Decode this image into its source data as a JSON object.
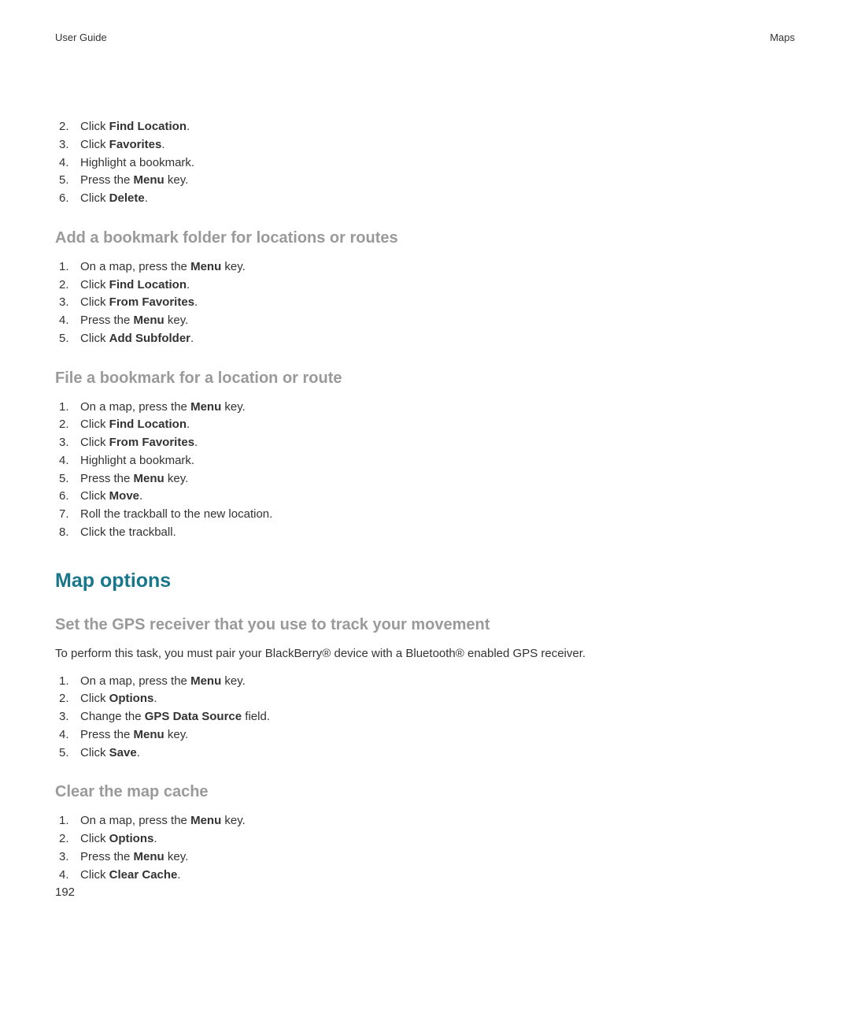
{
  "header": {
    "left": "User Guide",
    "right": "Maps"
  },
  "list1": {
    "start": 2,
    "items": [
      {
        "prefix": "Click ",
        "bold": "Find Location",
        "suffix": "."
      },
      {
        "prefix": "Click ",
        "bold": "Favorites",
        "suffix": "."
      },
      {
        "prefix": "Highlight a bookmark.",
        "bold": "",
        "suffix": ""
      },
      {
        "prefix": "Press the ",
        "bold": "Menu",
        "suffix": " key."
      },
      {
        "prefix": "Click ",
        "bold": "Delete",
        "suffix": "."
      }
    ]
  },
  "section2": {
    "heading": "Add a bookmark folder for locations or routes",
    "items": [
      {
        "prefix": "On a map, press the ",
        "bold": "Menu",
        "suffix": " key."
      },
      {
        "prefix": "Click ",
        "bold": "Find Location",
        "suffix": "."
      },
      {
        "prefix": "Click ",
        "bold": "From Favorites",
        "suffix": "."
      },
      {
        "prefix": "Press the ",
        "bold": "Menu",
        "suffix": " key."
      },
      {
        "prefix": "Click ",
        "bold": "Add Subfolder",
        "suffix": "."
      }
    ]
  },
  "section3": {
    "heading": "File a bookmark for a location or route",
    "items": [
      {
        "prefix": "On a map, press the ",
        "bold": "Menu",
        "suffix": " key."
      },
      {
        "prefix": "Click ",
        "bold": "Find Location",
        "suffix": "."
      },
      {
        "prefix": "Click ",
        "bold": "From Favorites",
        "suffix": "."
      },
      {
        "prefix": "Highlight a bookmark.",
        "bold": "",
        "suffix": ""
      },
      {
        "prefix": "Press the ",
        "bold": "Menu",
        "suffix": " key."
      },
      {
        "prefix": "Click ",
        "bold": "Move",
        "suffix": "."
      },
      {
        "prefix": "Roll the trackball to the new location.",
        "bold": "",
        "suffix": ""
      },
      {
        "prefix": "Click the trackball.",
        "bold": "",
        "suffix": ""
      }
    ]
  },
  "section4": {
    "heading": "Map options"
  },
  "section5": {
    "heading": "Set the GPS receiver that you use to track your movement",
    "intro": "To perform this task, you must pair your BlackBerry® device with a Bluetooth® enabled GPS receiver.",
    "items": [
      {
        "prefix": "On a map, press the ",
        "bold": "Menu",
        "suffix": " key."
      },
      {
        "prefix": "Click ",
        "bold": "Options",
        "suffix": "."
      },
      {
        "prefix": "Change the ",
        "bold": "GPS Data Source",
        "suffix": " field."
      },
      {
        "prefix": "Press the ",
        "bold": "Menu",
        "suffix": " key."
      },
      {
        "prefix": "Click ",
        "bold": "Save",
        "suffix": "."
      }
    ]
  },
  "section6": {
    "heading": "Clear the map cache",
    "items": [
      {
        "prefix": "On a map, press the ",
        "bold": "Menu",
        "suffix": " key."
      },
      {
        "prefix": "Click ",
        "bold": "Options",
        "suffix": "."
      },
      {
        "prefix": "Press the ",
        "bold": "Menu",
        "suffix": " key."
      },
      {
        "prefix": "Click ",
        "bold": "Clear Cache",
        "suffix": "."
      }
    ]
  },
  "pageNumber": "192"
}
